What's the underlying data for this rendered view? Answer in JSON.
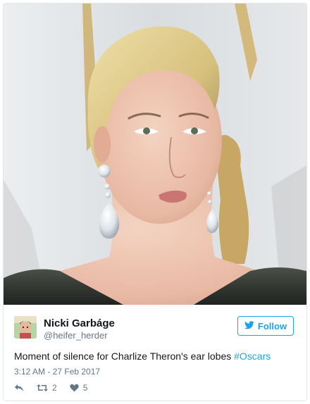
{
  "tweet": {
    "display_name": "Nicki Garbáge",
    "handle": "@heifer_herder",
    "follow_label": "Follow",
    "text": "Moment of silence for Charlize Theron's ear lobes ",
    "hashtag": "#Oscars",
    "timestamp": "3:12 AM - 27 Feb 2017",
    "retweet_count": "2",
    "like_count": "5"
  },
  "icons": {
    "reply": "reply-icon",
    "retweet": "retweet-icon",
    "like": "heart-icon",
    "follow": "twitter-bird-icon"
  },
  "colors": {
    "accent": "#1da1f2",
    "secondary_text": "#657786",
    "border": "#e1e8ed"
  }
}
